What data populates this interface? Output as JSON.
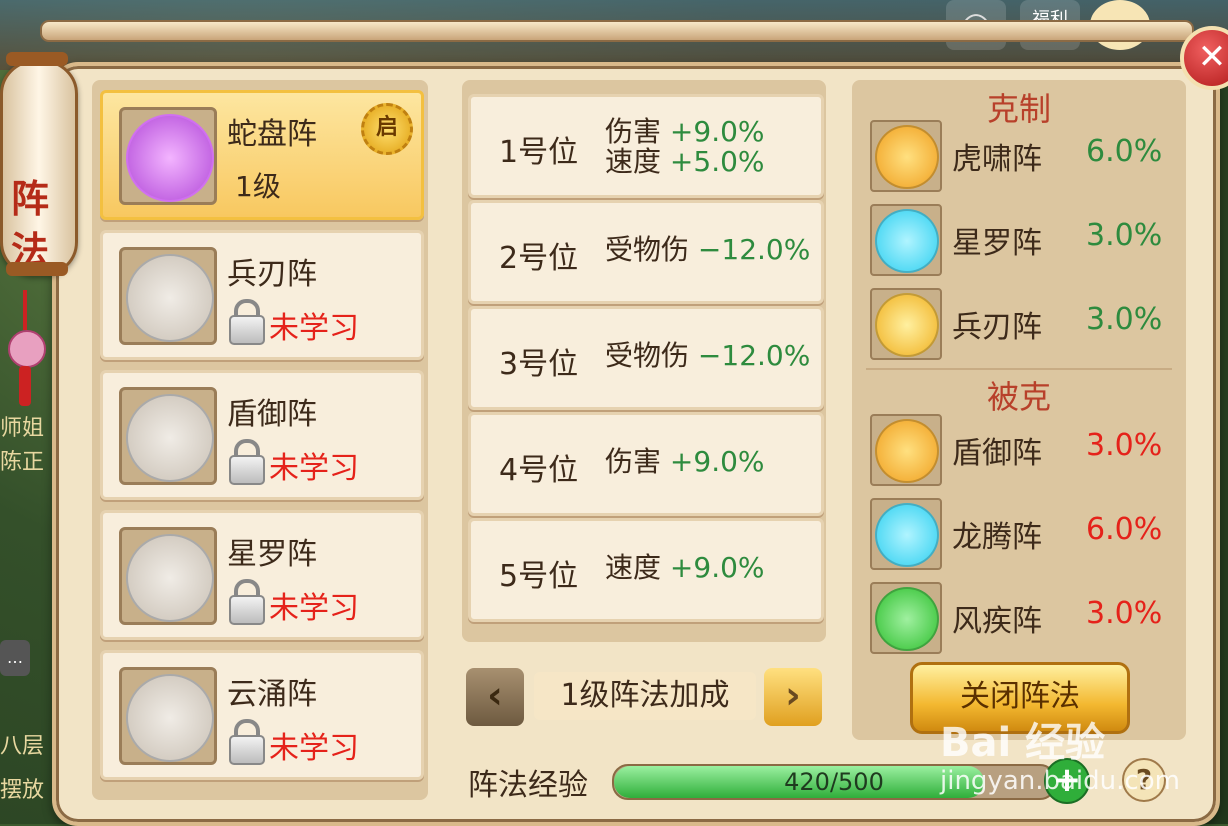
{
  "window": {
    "title": "阵法"
  },
  "top_bar": {
    "camera_icon": "camera-icon",
    "gift_label": "福利"
  },
  "side": {
    "text1": "师姐",
    "text2": "陈正",
    "text3": "八层",
    "text4": "摆放"
  },
  "formations": [
    {
      "name": "蛇盘阵",
      "level": "1级",
      "status": "",
      "active": true,
      "badge": "启"
    },
    {
      "name": "兵刃阵",
      "level": "",
      "status": "未学习",
      "active": false
    },
    {
      "name": "盾御阵",
      "level": "",
      "status": "未学习",
      "active": false
    },
    {
      "name": "星罗阵",
      "level": "",
      "status": "未学习",
      "active": false
    },
    {
      "name": "云涌阵",
      "level": "",
      "status": "未学习",
      "active": false
    }
  ],
  "positions": [
    {
      "label": "1号位",
      "attrs": [
        {
          "name": "伤害",
          "value": "+9.0%"
        },
        {
          "name": "速度",
          "value": "+5.0%"
        }
      ]
    },
    {
      "label": "2号位",
      "attrs": [
        {
          "name": "受物伤",
          "value": "−12.0%"
        }
      ]
    },
    {
      "label": "3号位",
      "attrs": [
        {
          "name": "受物伤",
          "value": "−12.0%"
        }
      ]
    },
    {
      "label": "4号位",
      "attrs": [
        {
          "name": "伤害",
          "value": "+9.0%"
        }
      ]
    },
    {
      "label": "5号位",
      "attrs": [
        {
          "name": "速度",
          "value": "+9.0%"
        }
      ]
    }
  ],
  "level_nav": {
    "label": "1级阵法加成",
    "prev": "‹",
    "next": "›"
  },
  "counters": {
    "title": "克制",
    "items": [
      {
        "name": "虎啸阵",
        "value": "6.0%",
        "color": "#f0a020"
      },
      {
        "name": "星罗阵",
        "value": "3.0%",
        "color": "#30d0f0"
      },
      {
        "name": "兵刃阵",
        "value": "3.0%",
        "color": "#f0b020"
      }
    ]
  },
  "countered_by": {
    "title": "被克",
    "items": [
      {
        "name": "盾御阵",
        "value": "3.0%",
        "color": "#f0a020"
      },
      {
        "name": "龙腾阵",
        "value": "6.0%",
        "color": "#30d0f0"
      },
      {
        "name": "风疾阵",
        "value": "3.0%",
        "color": "#30c030"
      }
    ]
  },
  "close_button": "关闭阵法",
  "experience": {
    "label": "阵法经验",
    "current": 420,
    "max": 500,
    "text": "420/500",
    "progress": 0.84
  },
  "watermark": {
    "brand": "Bai 经验",
    "url": "jingyan.baidu.com"
  }
}
